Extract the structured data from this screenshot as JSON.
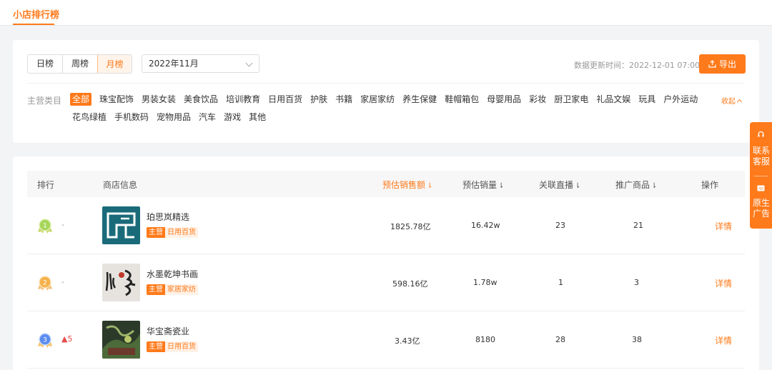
{
  "topbar": {
    "tab_label": "小店排行榜"
  },
  "period_tabs": [
    {
      "label": "日榜",
      "active": false
    },
    {
      "label": "周榜",
      "active": false
    },
    {
      "label": "月榜",
      "active": true
    }
  ],
  "month_select": {
    "value": "2022年11月"
  },
  "update_time": "数据更新时间：2022-12-01 07:00",
  "export_label": "导出",
  "category": {
    "label": "主营类目",
    "collapse_label": "收起",
    "row1": [
      "全部",
      "珠宝配饰",
      "男装女装",
      "美食饮品",
      "培训教育",
      "日用百货",
      "护肤",
      "书籍",
      "家居家纺",
      "养生保健",
      "鞋帽箱包",
      "母婴用品",
      "彩妆",
      "厨卫家电",
      "礼品文娱",
      "玩具",
      "户外运动"
    ],
    "row2": [
      "花鸟绿植",
      "手机数码",
      "宠物用品",
      "汽车",
      "游戏",
      "其他"
    ],
    "active": "全部"
  },
  "table": {
    "headers": {
      "rank": "排行",
      "shop": "商店信息",
      "sales_amount": "预估销售额",
      "sales_volume": "预估销量",
      "live": "关联直播",
      "products": "推广商品",
      "action": "操作"
    },
    "sort_arrow": "⇂",
    "main_tag": "主营",
    "detail_label": "详情",
    "rows": [
      {
        "rank": "1",
        "change": "-",
        "name": "珀思岚精选",
        "category": "日用百货",
        "sales_amount": "1825.78亿",
        "sales_volume": "16.42w",
        "live": "23",
        "products": "21"
      },
      {
        "rank": "2",
        "change": "-",
        "name": "水墨乾坤书画",
        "category": "家居家纺",
        "sales_amount": "598.16亿",
        "sales_volume": "1.78w",
        "live": "1",
        "products": "3"
      },
      {
        "rank": "3",
        "change": "▲5",
        "name": "华宝斋瓷业",
        "category": "日用百货",
        "sales_amount": "3.43亿",
        "sales_volume": "8180",
        "live": "28",
        "products": "38"
      }
    ]
  },
  "float_panel": {
    "contact": "联系客服",
    "native_ad": "原生广告",
    "ad_icon_text": "AD"
  },
  "colors": {
    "accent": "#ff7a1a",
    "gold": "#f5b14a",
    "green": "#8bc34a",
    "blue": "#5b8def"
  }
}
